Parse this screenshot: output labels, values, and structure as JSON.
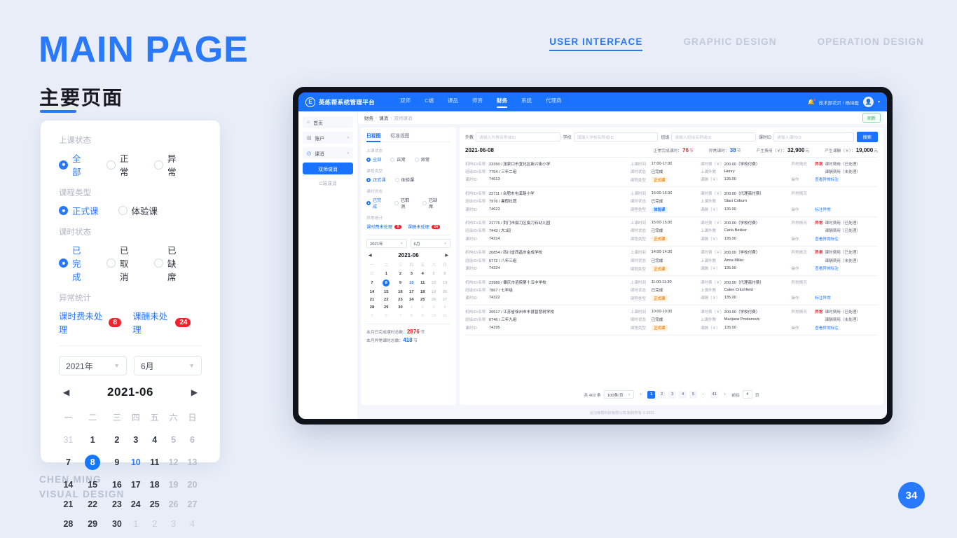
{
  "slide": {
    "title": "MAIN PAGE",
    "subtitle": "主要页面",
    "credit_line1": "CHEN MING",
    "credit_line2": "VISUAL DESIGN",
    "page_number": "34",
    "accent_color": "#2979ff",
    "nav": [
      {
        "label": "USER INTERFACE",
        "active": true
      },
      {
        "label": "GRAPHIC DESIGN",
        "active": false
      },
      {
        "label": "OPERATION DESIGN",
        "active": false
      }
    ]
  },
  "detail_card": {
    "filters": [
      {
        "label": "上课状态",
        "options": [
          "全部",
          "正常",
          "异常"
        ],
        "selected": 0
      },
      {
        "label": "课程类型",
        "options": [
          "正式课",
          "体验课"
        ],
        "selected": 0
      },
      {
        "label": "课时状态",
        "options": [
          "已完成",
          "已取消",
          "已缺席"
        ],
        "selected": 0
      }
    ],
    "stats_label": "异常统计",
    "stats": [
      {
        "label": "课时费未处理",
        "count": "8"
      },
      {
        "label": "课酬未处理",
        "count": "24"
      }
    ],
    "year_select": "2021年",
    "month_select": "6月",
    "cal_title": "2021-06",
    "prev_icon": "◀",
    "next_icon": "▶",
    "weekdays": [
      "一",
      "二",
      "三",
      "四",
      "五",
      "六",
      "日"
    ],
    "weeks": [
      [
        {
          "d": "31",
          "t": "mute"
        },
        {
          "d": "1"
        },
        {
          "d": "2"
        },
        {
          "d": "3"
        },
        {
          "d": "4"
        },
        {
          "d": "5",
          "t": "wk"
        },
        {
          "d": "6",
          "t": "wk"
        }
      ],
      [
        {
          "d": "7"
        },
        {
          "d": "8",
          "t": "sel"
        },
        {
          "d": "9"
        },
        {
          "d": "10",
          "t": "blue"
        },
        {
          "d": "11"
        },
        {
          "d": "12",
          "t": "wk"
        },
        {
          "d": "13",
          "t": "wk"
        }
      ],
      [
        {
          "d": "14"
        },
        {
          "d": "15"
        },
        {
          "d": "16"
        },
        {
          "d": "17"
        },
        {
          "d": "18"
        },
        {
          "d": "19",
          "t": "wk"
        },
        {
          "d": "20",
          "t": "wk"
        }
      ],
      [
        {
          "d": "21"
        },
        {
          "d": "22"
        },
        {
          "d": "23"
        },
        {
          "d": "24"
        },
        {
          "d": "25"
        },
        {
          "d": "26",
          "t": "wk"
        },
        {
          "d": "27",
          "t": "wk"
        }
      ],
      [
        {
          "d": "28"
        },
        {
          "d": "29"
        },
        {
          "d": "30"
        },
        {
          "d": "1",
          "t": "mute"
        },
        {
          "d": "2",
          "t": "mute"
        },
        {
          "d": "3",
          "t": "mute"
        },
        {
          "d": "4",
          "t": "mute"
        }
      ]
    ]
  },
  "app": {
    "brand": "英练帮系统管理平台",
    "logo_glyph": "E",
    "nav": [
      {
        "label": "双师",
        "active": false
      },
      {
        "label": "C端",
        "active": false
      },
      {
        "label": "课品",
        "active": false
      },
      {
        "label": "师资",
        "active": false
      },
      {
        "label": "财务",
        "active": true
      },
      {
        "label": "系统",
        "active": false
      },
      {
        "label": "代理商",
        "active": false
      }
    ],
    "user": "技术部花贝 / 杨诗盈",
    "bell_icon": "🔔",
    "avatar_icon": "👤",
    "sidebar": [
      {
        "label": "首页",
        "icon": "⌂",
        "has_arrow": false,
        "type": "item"
      },
      {
        "label": "账户",
        "icon": "▤",
        "has_arrow": true,
        "type": "item"
      },
      {
        "label": "课消",
        "icon": "◴",
        "has_arrow": true,
        "type": "item-active"
      },
      {
        "label": "双师课消",
        "type": "sub-active"
      },
      {
        "label": "C端课消",
        "type": "sub"
      }
    ],
    "breadcrumb": [
      "财务",
      "课消",
      "双师课消"
    ],
    "refresh_label": "刷新",
    "view_tabs": [
      {
        "label": "日视图",
        "active": true
      },
      {
        "label": "标准视图",
        "active": false
      }
    ],
    "filters": [
      {
        "label": "上课状态",
        "options": [
          "全部",
          "正常",
          "异常"
        ],
        "selected": 0
      },
      {
        "label": "课程类型",
        "options": [
          "正式课",
          "体验课"
        ],
        "selected": 0
      },
      {
        "label": "课时状态",
        "options": [
          "已完成",
          "已取消",
          "已缺席"
        ],
        "selected": 0
      }
    ],
    "stats_label": "异常统计",
    "stats": [
      {
        "label": "课时费未处理",
        "count": "8"
      },
      {
        "label": "课酬未处理",
        "count": "24"
      }
    ],
    "year_select": "2021年",
    "month_select": "6月",
    "cal_title": "2021-06",
    "weekdays": [
      "一",
      "二",
      "三",
      "四",
      "五",
      "六",
      "日"
    ],
    "weeks": [
      [
        {
          "d": "31",
          "t": "mute"
        },
        {
          "d": "1"
        },
        {
          "d": "2"
        },
        {
          "d": "3"
        },
        {
          "d": "4"
        },
        {
          "d": "5",
          "t": "wk"
        },
        {
          "d": "6",
          "t": "wk"
        }
      ],
      [
        {
          "d": "7"
        },
        {
          "d": "8",
          "t": "sel"
        },
        {
          "d": "9"
        },
        {
          "d": "10",
          "t": "blue"
        },
        {
          "d": "11"
        },
        {
          "d": "12",
          "t": "wk"
        },
        {
          "d": "13",
          "t": "wk"
        }
      ],
      [
        {
          "d": "14"
        },
        {
          "d": "15"
        },
        {
          "d": "16"
        },
        {
          "d": "17"
        },
        {
          "d": "18"
        },
        {
          "d": "19",
          "t": "wk"
        },
        {
          "d": "20",
          "t": "wk"
        }
      ],
      [
        {
          "d": "21"
        },
        {
          "d": "22"
        },
        {
          "d": "23"
        },
        {
          "d": "24"
        },
        {
          "d": "25"
        },
        {
          "d": "26",
          "t": "wk"
        },
        {
          "d": "27",
          "t": "wk"
        }
      ],
      [
        {
          "d": "28"
        },
        {
          "d": "29"
        },
        {
          "d": "30"
        },
        {
          "d": "1",
          "t": "mute"
        },
        {
          "d": "2",
          "t": "mute"
        },
        {
          "d": "3",
          "t": "mute"
        },
        {
          "d": "4",
          "t": "mute"
        }
      ],
      [
        {
          "d": "5",
          "t": "mute"
        },
        {
          "d": "6",
          "t": "mute"
        },
        {
          "d": "7",
          "t": "mute"
        },
        {
          "d": "8",
          "t": "mute"
        },
        {
          "d": "9",
          "t": "mute"
        },
        {
          "d": "10",
          "t": "mute"
        },
        {
          "d": "11",
          "t": "mute"
        }
      ]
    ],
    "month_stats": [
      {
        "label": "本月已完成课时总数：",
        "value": "2876",
        "unit": "节",
        "color": "red"
      },
      {
        "label": "本月异常课时总数：",
        "value": "418",
        "unit": "节",
        "color": "blue"
      }
    ],
    "search": [
      {
        "label": "外教",
        "placeholder": "请输入外教名称或ID"
      },
      {
        "label": "学校",
        "placeholder": "请输入学校名称或ID"
      },
      {
        "label": "班级",
        "placeholder": "请输入班级名称或ID"
      },
      {
        "label": "课时ID",
        "placeholder": "请输入课时ID"
      }
    ],
    "search_button": "搜索",
    "summary": {
      "date": "2021-06-08",
      "items": [
        {
          "label": "正常完成课时：",
          "value": "76",
          "unit": "节",
          "color": "red"
        },
        {
          "label": "异常课时：",
          "value": "38",
          "unit": "节",
          "color": "blue"
        },
        {
          "label": "产生费用（￥）：",
          "value": "32,900",
          "unit": "元",
          "color": "dark"
        },
        {
          "label": "产生课酬（￥）：",
          "value": "19,000",
          "unit": "元",
          "color": "dark"
        }
      ]
    },
    "row_labels": {
      "org": "机构ID/名称",
      "cls": "班级ID/名称",
      "lesson": "课时ID",
      "time": "上课时间",
      "status": "课时状态",
      "ctype": "课程类型",
      "fee": "课时费（￥）",
      "teacher": "上课外教",
      "pay": "课酬（￥）",
      "abnormal": "异常情况",
      "action": "操作"
    },
    "rows": [
      {
        "org": "23350 / 张家口市宣化区新兴街小学",
        "cls": "7754 / 三年二组",
        "lesson": "74613",
        "time": "17:00-17:30",
        "status": "已完成",
        "ctype": "正式课",
        "ctype_kind": "formal",
        "fee": "200.00（学校付费）",
        "teacher": "Henry",
        "pay": "135.00",
        "abnormal_tag": "异常",
        "abnormal_1": "课时费用（已处理）",
        "abnormal_2": "课酬费用（未处理）",
        "action": "查看异常标注"
      },
      {
        "org": "22711 / 合肥市屯溪路小学",
        "cls": "7976 / 暑假社团",
        "lesson": "74623",
        "time": "16:00-16:30",
        "status": "已完成",
        "ctype": "体验课",
        "ctype_kind": "trial",
        "fee": "200.00（代理商付费）",
        "teacher": "Staci Coburn",
        "pay": "135.00",
        "abnormal_tag": "",
        "abnormal_1": "",
        "abnormal_2": "",
        "action": "标注异常"
      },
      {
        "org": "21776 / 荆门市掇刀区掇刀石幼儿园",
        "cls": "7443 / 大1班",
        "lesson": "74314",
        "time": "15:00-15:30",
        "status": "已完成",
        "ctype": "正式课",
        "ctype_kind": "formal",
        "fee": "200.00（学校付费）",
        "teacher": "Carla Bekker",
        "pay": "135.00",
        "abnormal_tag": "异常",
        "abnormal_1": "课时费用（已处理）",
        "abnormal_2": "课酬费用（已处理）",
        "action": "查看异常标注"
      },
      {
        "org": "20854 / 四川省西昌市金成学校",
        "cls": "6772 / 八年三组",
        "lesson": "74324",
        "time": "14:00-14:30",
        "status": "已完成",
        "ctype": "正式课",
        "ctype_kind": "formal",
        "fee": "200.00（学校付费）",
        "teacher": "Anna Miller",
        "pay": "135.00",
        "abnormal_tag": "异常",
        "abnormal_1": "课时费用（已处理）",
        "abnormal_2": "课酬费用（未处理）",
        "action": "查看异常标注"
      },
      {
        "org": "23980 / 肇庆市谊院第十五中学校",
        "cls": "7867 / 七年级",
        "lesson": "74322",
        "time": "11:00-11:30",
        "status": "已完成",
        "ctype": "正式课",
        "ctype_kind": "formal",
        "fee": "200.00（代理商付费）",
        "teacher": "Calen Critchfield",
        "pay": "135.00",
        "abnormal_tag": "",
        "abnormal_1": "",
        "abnormal_2": "",
        "action": "标注异常"
      },
      {
        "org": "20517 / 江苏省徐州市丰县智慧树学校",
        "cls": "6746 / 三年九组",
        "lesson": "74295",
        "time": "10:00-10:30",
        "status": "已完成",
        "ctype": "正式课",
        "ctype_kind": "formal",
        "fee": "200.00（学校付费）",
        "teacher": "Marijana Prodanovic",
        "pay": "135.00",
        "abnormal_tag": "异常",
        "abnormal_1": "课时费用（已处理）",
        "abnormal_2": "课酬费用（未处理）",
        "action": "查看异常标注"
      }
    ],
    "pagination": {
      "total": "共 402 条",
      "page_size": "100条/页",
      "prev": "‹",
      "next": "›",
      "pages": [
        "1",
        "2",
        "3",
        "4",
        "5",
        "···",
        "41"
      ],
      "current": "1",
      "goto_label": "前往",
      "goto_value": "4",
      "goto_unit": "页"
    },
    "footer": "武汉练帮科技有限公司 版权所有 © 2021"
  }
}
